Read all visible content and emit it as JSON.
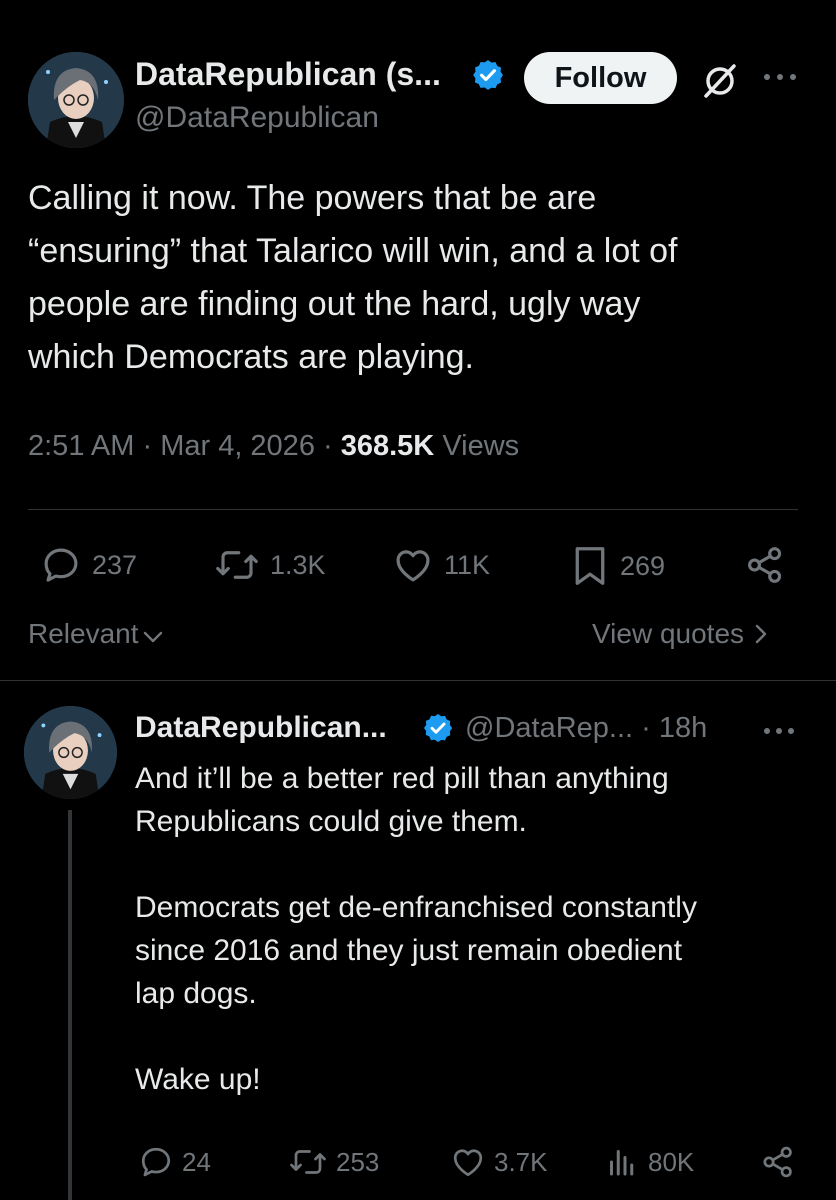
{
  "tweet": {
    "author_name": "DataRepublican (s...",
    "handle": "@DataRepublican",
    "follow_label": "Follow",
    "text_lines": [
      "Calling it now. The powers that be are",
      "“ensuring” that Talarico will win, and a lot of",
      "people are finding out the hard, ugly way",
      "which Democrats are playing."
    ],
    "time": "2:51 AM",
    "date": "Mar 4, 2026",
    "views_count": "368.5K",
    "views_label": "Views",
    "stats": {
      "replies": "237",
      "reposts": "1.3K",
      "likes": "11K",
      "bookmarks": "269"
    }
  },
  "sort": {
    "label": "Relevant",
    "view_quotes": "View quotes"
  },
  "reply": {
    "author_name": "DataRepublican...",
    "handle": "@DataRep...",
    "age": "18h",
    "lines": [
      "And it’ll be a better red pill than anything",
      "Republicans could give them.",
      "",
      "Democrats get de-enfranchised constantly",
      "since 2016 and they just remain obedient",
      "lap dogs.",
      "",
      "Wake up!"
    ],
    "stats": {
      "replies": "24",
      "reposts": "253",
      "likes": "3.7K",
      "views": "80K"
    }
  },
  "colors": {
    "background": "#000000",
    "verified": "#1d9bf0",
    "muted": "#71767b",
    "text": "#e7e9ea"
  }
}
